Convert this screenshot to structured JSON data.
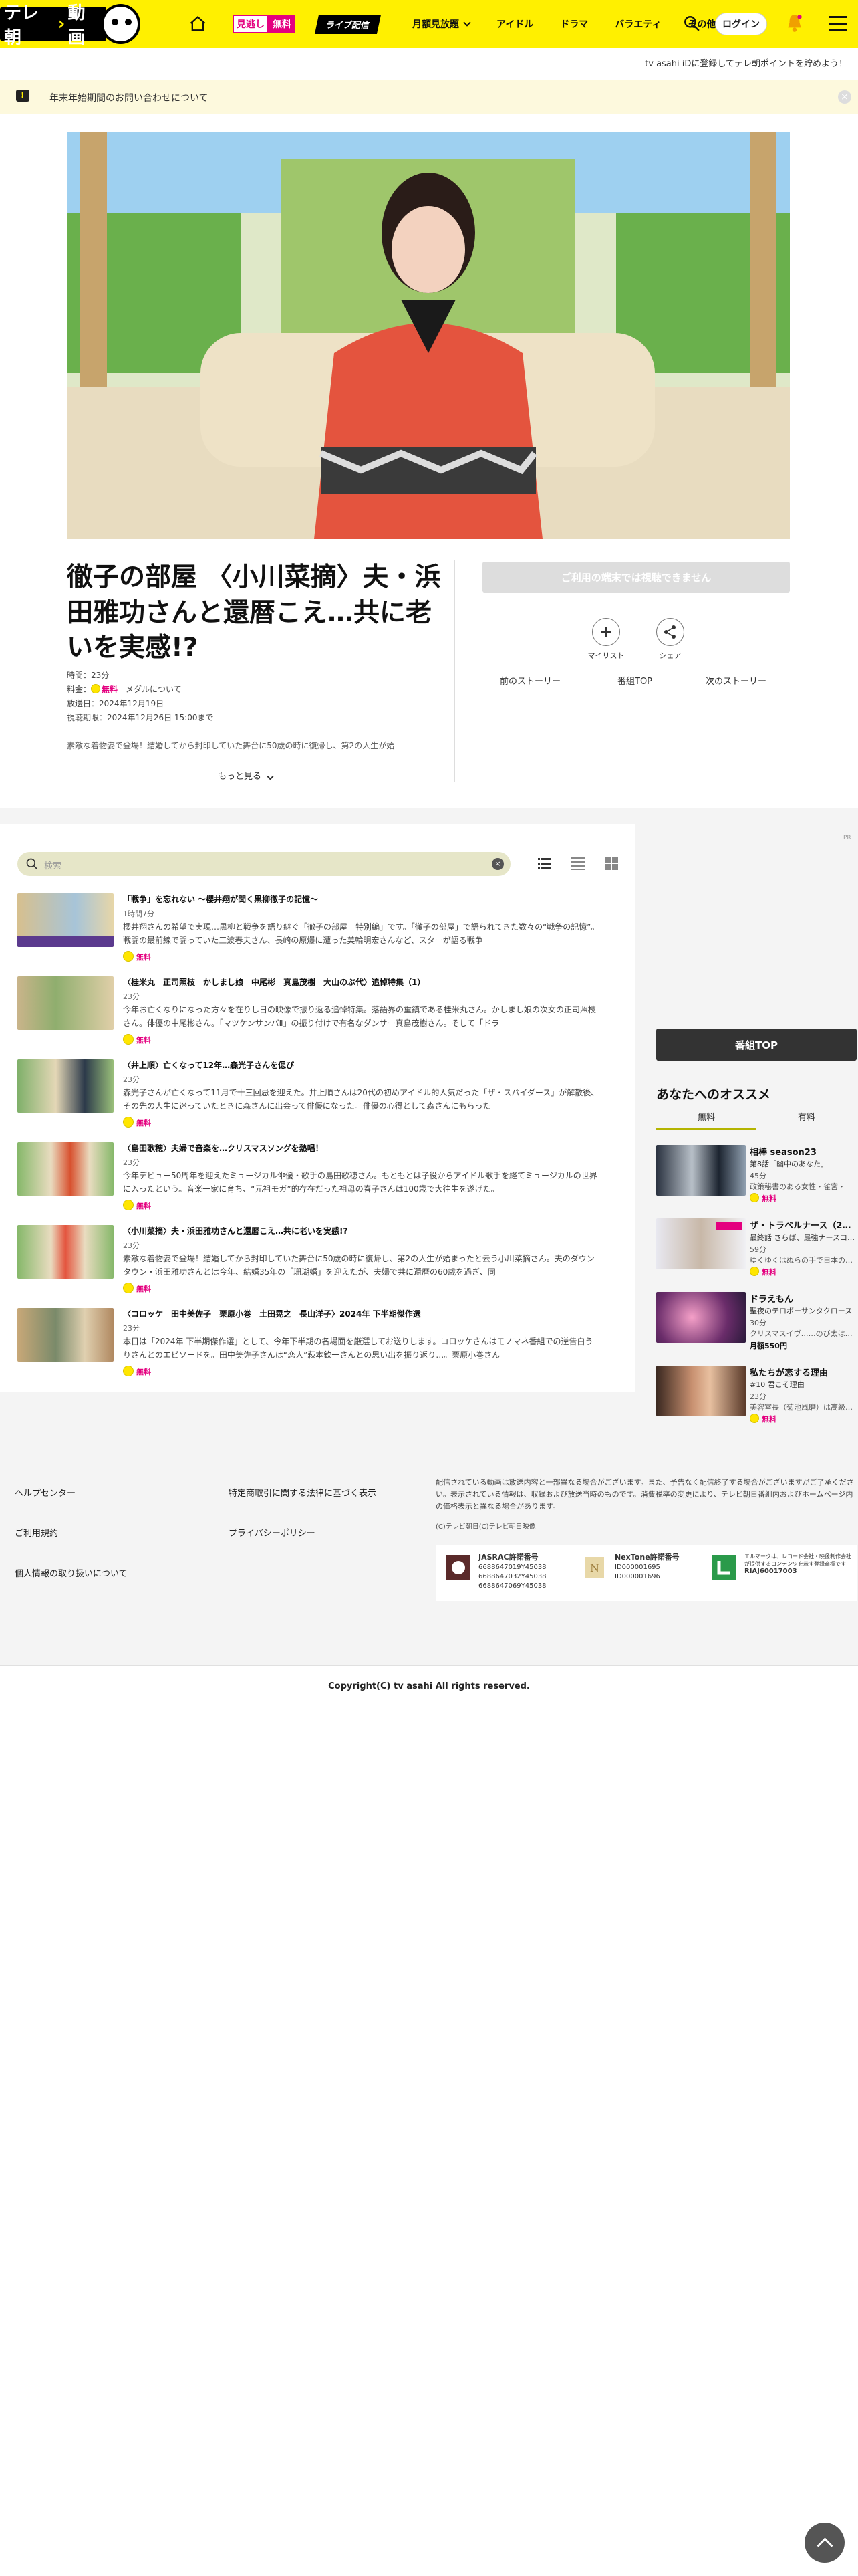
{
  "header": {
    "logo_text": "テレ朝",
    "logo_text2": "動画",
    "mi_label": "見逃し",
    "free_label": "無料",
    "live_label": "ライブ配信",
    "nav": [
      "月額見放題",
      "アイドル",
      "ドラマ",
      "バラエティ",
      "その他"
    ],
    "login_label": "ログイン",
    "promo_text": "tv asahi iDに登録してテレ朝ポイントを貯めよう！"
  },
  "notice": {
    "text": "年末年始期間のお問い合わせについて"
  },
  "program": {
    "title": "徹子の部屋 〈小川菜摘〉夫・浜田雅功さんと還暦こえ…共に老いを実感!?",
    "meta": {
      "duration_label": "時間：",
      "duration": "23分",
      "fee_label": "料金：",
      "fee": "無料",
      "fee_link": "メダルについて",
      "aired_label": "放送日：",
      "aired": "2024年12月19日",
      "deadline_label": "視聴期限：",
      "deadline": "2024年12月26日 15:00まで"
    },
    "description": "素敵な着物姿で登場！結婚してから封印していた舞台に50歳の時に復帰し、第2の人生が始",
    "more_label": "もっと見る",
    "unavailable_label": "ご利用の端末では視聴できません",
    "mylist_label": "マイリスト",
    "share_label": "シェア",
    "prev_story": "前のストーリー",
    "program_top": "番組TOP",
    "next_story": "次のストーリー"
  },
  "episodes_search": {
    "placeholder": "検索"
  },
  "ad_label": "PR",
  "episodes": [
    {
      "title": "「戦争」を忘れない ～櫻井翔が聞く黒柳徹子の記憶～",
      "duration": "1時間7分",
      "desc": "櫻井翔さんの希望で実現…黒柳と戦争を語り継ぐ「徹子の部屋　特別編」です。「徹子の部屋」で語られてきた数々の“戦争の記憶”。戦闘の最前線で闘っていた三波春夫さん、長崎の原爆に遭った美輪明宏さんなど、スターが語る戦争",
      "free": "無料"
    },
    {
      "title": "〈桂米丸　正司照枝　かしまし娘　中尾彬　真島茂樹　大山のぶ代〉追悼特集（1）",
      "duration": "23分",
      "desc": "今年お亡くなりになった方々を在りし日の映像で振り返る追悼特集。落語界の重鎮である桂米丸さん。かしまし娘の次女の正司照枝さん。俳優の中尾彬さん。「マツケンサンバⅡ」の振り付けで有名なダンサー真島茂樹さん。そして「ドラ",
      "free": "無料"
    },
    {
      "title": "〈井上順〉亡くなって12年…森光子さんを偲び",
      "duration": "23分",
      "desc": "森光子さんが亡くなって11月で十三回忌を迎えた。井上順さんは20代の初めアイドル的人気だった「ザ・スパイダース」が解散後、その先の人生に迷っていたときに森さんに出会って俳優になった。俳優の心得として森さんにもらった",
      "free": "無料"
    },
    {
      "title": "〈島田歌穂〉夫婦で音楽を…クリスマスソングを熱唱！",
      "duration": "23分",
      "desc": "今年デビュー50周年を迎えたミュージカル俳優・歌手の島田歌穂さん。もともとは子役からアイドル歌手を経てミュージカルの世界に入ったという。音楽一家に育ち、“元祖モガ”的存在だった祖母の春子さんは100歳で大往生を遂げた。",
      "free": "無料"
    },
    {
      "title": "〈小川菜摘〉夫・浜田雅功さんと還暦こえ…共に老いを実感!?",
      "duration": "23分",
      "desc": "素敵な着物姿で登場！結婚してから封印していた舞台に50歳の時に復帰し、第2の人生が始まったと云う小川菜摘さん。夫のダウンタウン・浜田雅功さんとは今年、結婚35年の「珊瑚婚」を迎えたが、夫婦で共に還暦の60歳を過ぎ、同",
      "free": "無料"
    },
    {
      "title": "〈コロッケ　田中美佐子　栗原小巻　土田晃之　長山洋子〉2024年 下半期傑作選",
      "duration": "23分",
      "desc": "本日は「2024年 下半期傑作選」として、今年下半期の名場面を厳選してお送りします。コロッケさんはモノマネ番組での逆告白うりさんとのエピソードを。田中美佐子さんは“恋人”萩本欽一さんとの思い出を振り返り…。栗原小巻さん",
      "free": "無料"
    }
  ],
  "sidebar": {
    "program_top": "番組TOP",
    "recommend_title": "あなたへのオススメ",
    "tabs": [
      "無料",
      "有料"
    ],
    "items": [
      {
        "title": "相棒 season23",
        "sub": "第8話「幽中のあなた」",
        "duration": "45分",
        "desc": "政策秘書のある女性・雀宮・",
        "fee": "無料",
        "paid": false
      },
      {
        "title": "ザ・トラベルナース（2…",
        "sub": "最終話 さらば、最強ナースコ…",
        "duration": "59分",
        "desc": "ゆくゆくはぬらの手で日本の…",
        "fee": "無料",
        "paid": false
      },
      {
        "title": "ドラえもん",
        "sub": "聖夜のテロポーサンタクロース",
        "duration": "30分",
        "desc": "クリスマスイヴ……のび太は…",
        "fee": "月額550円",
        "paid": true
      },
      {
        "title": "私たちが恋する理由",
        "sub": "#10 君こそ理由",
        "duration": "23分",
        "desc": "美容室長（菊池風磨）は高級…",
        "fee": "無料",
        "paid": false
      }
    ]
  },
  "footer": {
    "links_left": [
      "ヘルプセンター",
      "ご利用規約",
      "個人情報の取り扱いについて"
    ],
    "links_mid": [
      "特定商取引に関する法律に基づく表示",
      "プライバシーポリシー"
    ],
    "note": "配信されている動画は放送内容と一部異なる場合がございます。また、予告なく配信終了する場合がございますがご了承ください。表示されている情報は、収録および放送当時のものです。消費税率の変更により、テレビ朝日番組内およびホームページ内の価格表示と異なる場合があります。",
    "small_copy": "(C)テレビ朝日(C)テレビ朝日映像",
    "jasrac_title": "JASRAC許諾番号",
    "jasrac_nums": [
      "6688647019Y45038",
      "6688647032Y45038",
      "6688647069Y45038"
    ],
    "nextone_title": "NexTone許諾番号",
    "nextone_nums": [
      "ID000001695",
      "ID000001696"
    ],
    "lmark_text": "エルマークは、レコード会社・映像制作会社が提供するコンテンツを示す登録商標です",
    "lmark_num": "RIAJ60017003",
    "copyright": "Copyright(C) tv asahi All rights reserved."
  }
}
